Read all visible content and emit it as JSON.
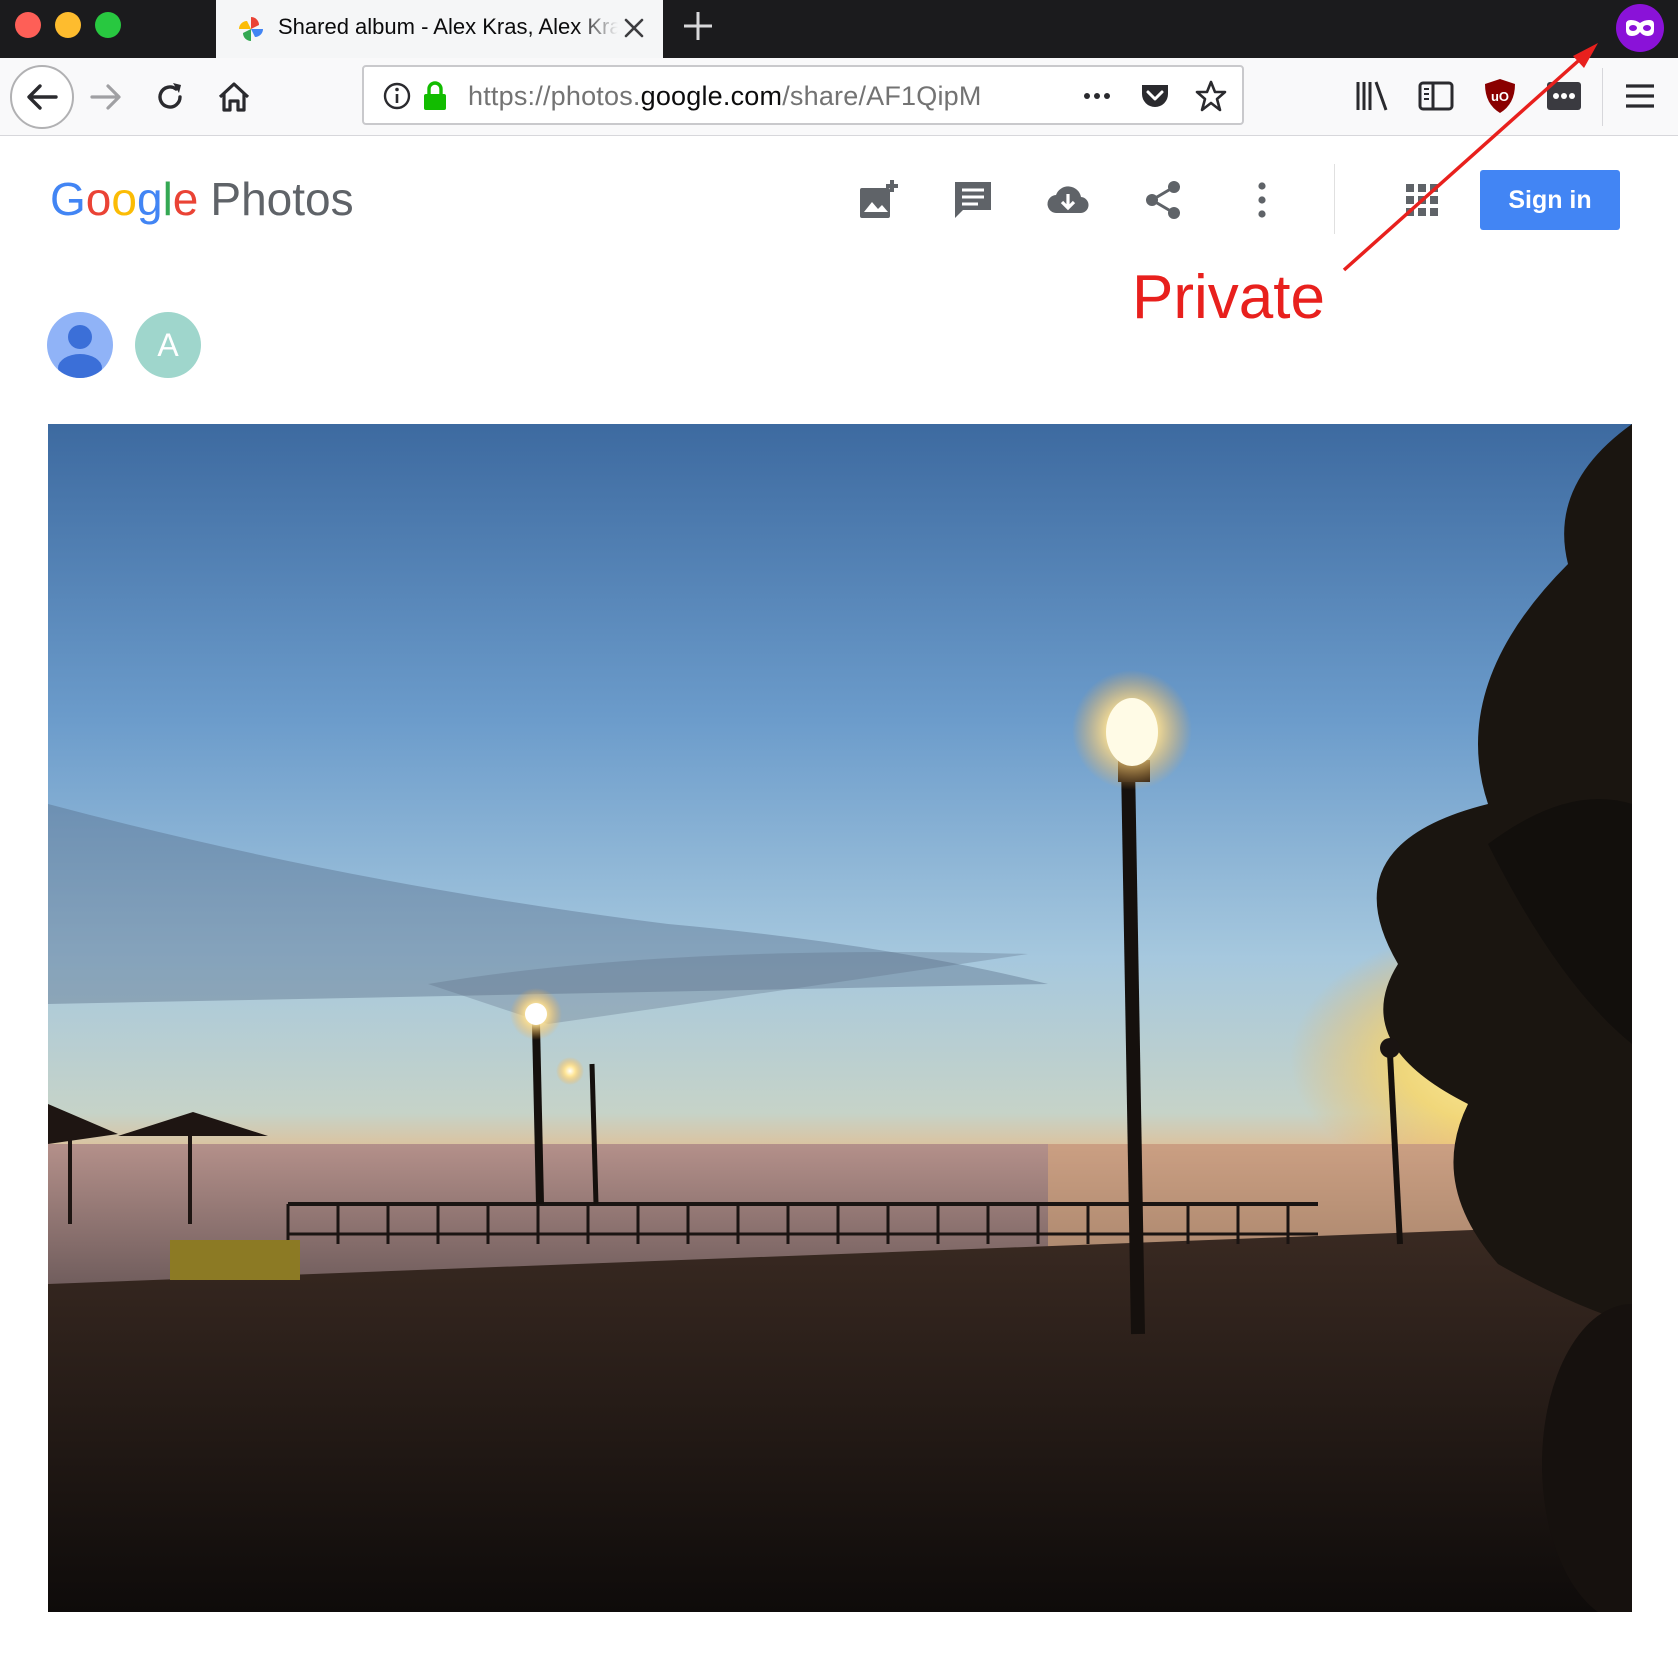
{
  "browser": {
    "tab": {
      "title": "Shared album - Alex Kras, Alex Kras"
    },
    "url": {
      "prefix": "https://photos.",
      "domain": "google.com",
      "path": "/share/AF1QipM"
    },
    "window_controls": [
      "close",
      "minimize",
      "maximize"
    ],
    "toolbar_icons": [
      "back-arrow-icon",
      "forward-arrow-icon",
      "reload-icon",
      "home-icon",
      "info-icon",
      "lock-icon",
      "more-dots-icon",
      "pocket-icon",
      "star-icon",
      "library-icon",
      "sidebar-icon",
      "ublock-icon",
      "lastpass-icon",
      "hamburger-menu-icon"
    ],
    "private_browsing_indicator": "mask-icon"
  },
  "page": {
    "logo": {
      "g1": "G",
      "o1": "o",
      "o2": "o",
      "g2": "g",
      "l": "l",
      "e": "e",
      "product": "Photos"
    },
    "header_icons": [
      "add-photo-icon",
      "comment-icon",
      "download-icon",
      "share-icon",
      "more-vert-icon",
      "apps-grid-icon"
    ],
    "signin_label": "Sign in",
    "avatars": [
      {
        "type": "person-silhouette",
        "color": "#90b3f7"
      },
      {
        "letter": "A",
        "color": "#9fd6cc"
      }
    ],
    "annotation": {
      "text": "Private",
      "color": "#e8201d"
    },
    "photo": {
      "subject": "ocean-sunset-with-street-lamps"
    }
  },
  "colors": {
    "signin_blue": "#4285f4",
    "annotation_red": "#e8201d",
    "private_purple": "#8a12d8"
  }
}
